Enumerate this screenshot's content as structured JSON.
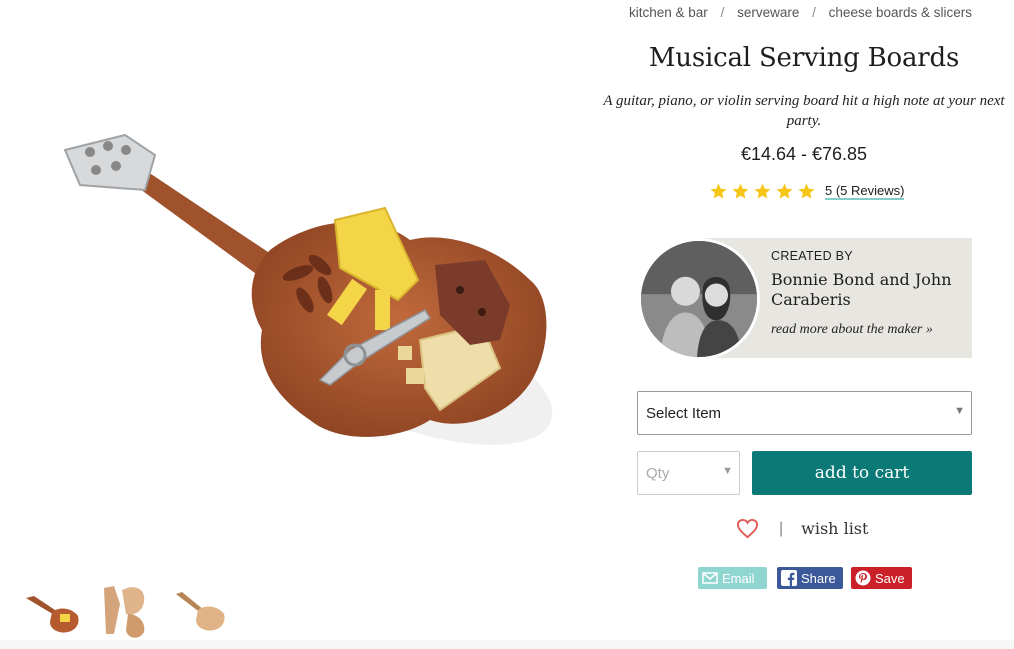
{
  "breadcrumb": {
    "items": [
      {
        "label": "kitchen & bar"
      },
      {
        "label": "serveware"
      },
      {
        "label": "cheese boards & slicers"
      }
    ],
    "separator": "/"
  },
  "product": {
    "title": "Musical Serving Boards",
    "tagline": "A guitar, piano, or violin serving board hit a high note at your next party.",
    "price": "€14.64 - €76.85",
    "rating": {
      "score": 5,
      "max": 5,
      "text": "5 (5 Reviews)"
    }
  },
  "maker": {
    "label": "CREATED BY",
    "name": "Bonnie Bond and John Caraberis",
    "link": "read more about the maker »"
  },
  "purchase": {
    "select_item": "Select Item",
    "qty_placeholder": "Qty",
    "add_to_cart": "add to cart"
  },
  "wishlist": {
    "separator": "|",
    "label": "wish list"
  },
  "share": {
    "email": "Email",
    "facebook": "Share",
    "pinterest": "Save"
  },
  "gallery": {
    "thumbnail_count": 3
  },
  "colors": {
    "accent": "#0b7a76",
    "star": "#f7c518",
    "facebook": "#3b5998",
    "pinterest": "#cb2027",
    "email": "#8fd5d0",
    "heart": "#e15a55"
  }
}
